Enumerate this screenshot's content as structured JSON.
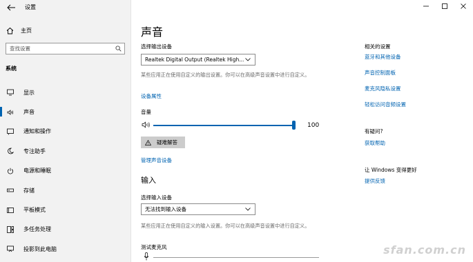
{
  "window": {
    "title": "设置",
    "controls": {
      "minimize": "—",
      "maximize": "☐",
      "close": "✕"
    }
  },
  "sidebar": {
    "home_label": "主页",
    "search_placeholder": "查找设置",
    "section_label": "系统",
    "items": [
      {
        "label": "显示",
        "icon": "monitor-icon"
      },
      {
        "label": "声音",
        "icon": "speaker-icon",
        "active": true
      },
      {
        "label": "通知和操作",
        "icon": "notification-icon"
      },
      {
        "label": "专注助手",
        "icon": "moon-icon"
      },
      {
        "label": "电源和睡眠",
        "icon": "power-icon"
      },
      {
        "label": "存储",
        "icon": "storage-icon"
      },
      {
        "label": "平板模式",
        "icon": "tablet-icon"
      },
      {
        "label": "多任务处理",
        "icon": "multitask-icon"
      },
      {
        "label": "投影到此电脑",
        "icon": "project-icon"
      }
    ]
  },
  "main": {
    "title": "声音",
    "output": {
      "label": "选择输出设备",
      "device": "Realtek Digital Output (Realtek High...",
      "description": "某些应用正在使用自定义的输出设置。你可以在高级声音设置中进行自定义。",
      "properties_link": "设备属性",
      "volume_label": "音量",
      "volume_value": "100",
      "volume_level": 1.0,
      "troubleshoot_label": "疑难解答",
      "manage_link": "管理声音设备"
    },
    "input": {
      "heading": "输入",
      "label": "选择输入设备",
      "device": "无法找到输入设备",
      "description": "某些应用正在使用自定义的输入设置。你可以在高级声音设置中进行自定义。",
      "test_label": "测试麦克风"
    }
  },
  "related": {
    "heading": "相关的设置",
    "links": [
      "蓝牙和其他设备",
      "声音控制面板",
      "麦克风隐私设置",
      "轻松访问音频设置"
    ],
    "help_heading": "有疑问?",
    "help_link": "获取帮助",
    "better_heading": "让 Windows 变得更好",
    "feedback_link": "提供反馈"
  },
  "watermark": "sfan.com.cn",
  "colors": {
    "accent": "#0063b1",
    "sidebar_bg": "#f2f2f2",
    "desc_text": "#6d6d6d"
  }
}
